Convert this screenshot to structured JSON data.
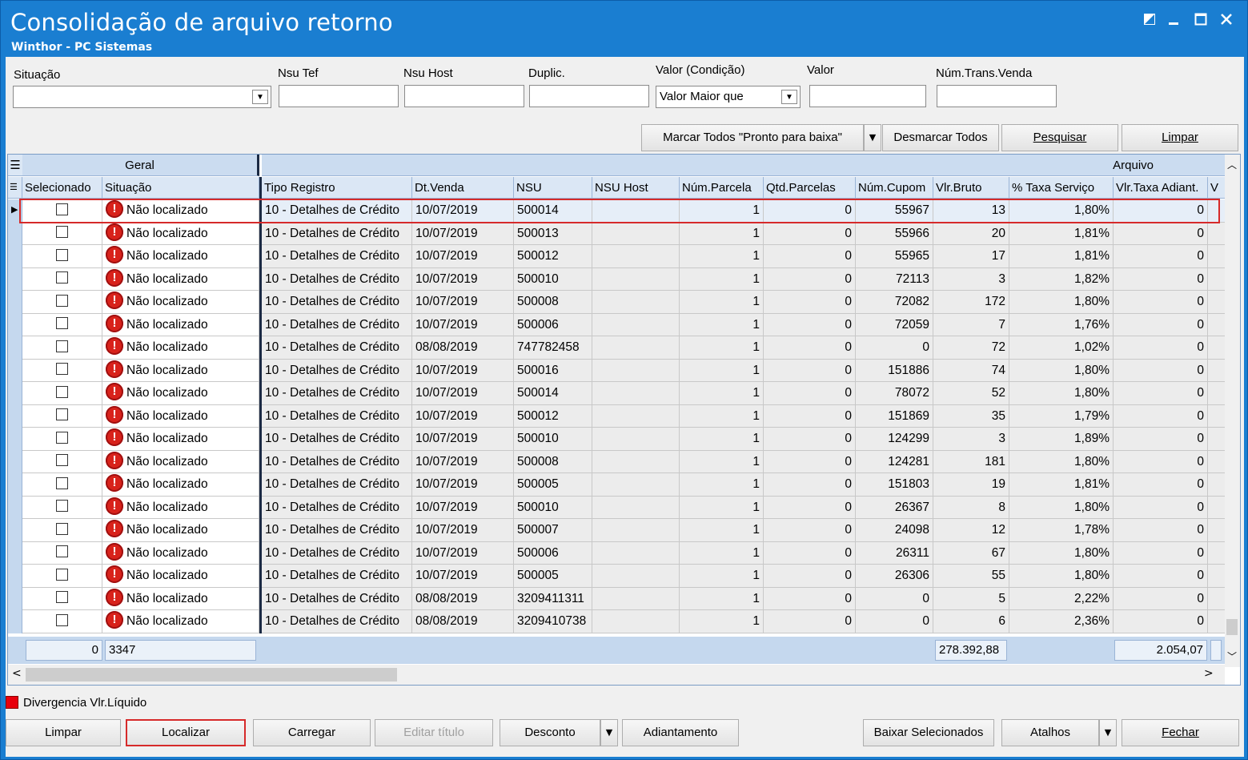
{
  "window": {
    "title": "Consolidação de arquivo retorno",
    "subtitle": "Winthor - PC Sistemas"
  },
  "filters": {
    "situacao_label": "Situação",
    "situacao_value": "",
    "nsu_tef_label": "Nsu Tef",
    "nsu_host_label": "Nsu Host",
    "duplic_label": "Duplic.",
    "valor_condicao_label": "Valor (Condição)",
    "valor_condicao_value": "Valor Maior que",
    "valor_label": "Valor",
    "num_trans_venda_label": "Núm.Trans.Venda"
  },
  "toolbar": {
    "marcar_todos": "Marcar Todos \"Pronto para baixa\"",
    "desmarcar_todos": "Desmarcar Todos",
    "pesquisar": "Pesquisar",
    "limpar": "Limpar"
  },
  "grid": {
    "band_geral": "Geral",
    "band_arquivo": "Arquivo",
    "columns": [
      "Selecionado",
      "Situação",
      "Tipo Registro",
      "Dt.Venda",
      "NSU",
      "NSU Host",
      "Núm.Parcela",
      "Qtd.Parcelas",
      "Núm.Cupom",
      "Vlr.Bruto",
      "% Taxa Serviço",
      "Vlr.Taxa Adiant.",
      "V"
    ],
    "rows": [
      {
        "situacao": "Não localizado",
        "tipo": "10 - Detalhes de Crédito",
        "dt": "10/07/2019",
        "nsu": "500014",
        "nsu_host": "",
        "parcela": "1",
        "qtd": "0",
        "cupom": "55967",
        "bruto": "13",
        "taxa": "1,80%",
        "adiant": "0"
      },
      {
        "situacao": "Não localizado",
        "tipo": "10 - Detalhes de Crédito",
        "dt": "10/07/2019",
        "nsu": "500013",
        "nsu_host": "",
        "parcela": "1",
        "qtd": "0",
        "cupom": "55966",
        "bruto": "20",
        "taxa": "1,81%",
        "adiant": "0"
      },
      {
        "situacao": "Não localizado",
        "tipo": "10 - Detalhes de Crédito",
        "dt": "10/07/2019",
        "nsu": "500012",
        "nsu_host": "",
        "parcela": "1",
        "qtd": "0",
        "cupom": "55965",
        "bruto": "17",
        "taxa": "1,81%",
        "adiant": "0"
      },
      {
        "situacao": "Não localizado",
        "tipo": "10 - Detalhes de Crédito",
        "dt": "10/07/2019",
        "nsu": "500010",
        "nsu_host": "",
        "parcela": "1",
        "qtd": "0",
        "cupom": "72113",
        "bruto": "3",
        "taxa": "1,82%",
        "adiant": "0"
      },
      {
        "situacao": "Não localizado",
        "tipo": "10 - Detalhes de Crédito",
        "dt": "10/07/2019",
        "nsu": "500008",
        "nsu_host": "",
        "parcela": "1",
        "qtd": "0",
        "cupom": "72082",
        "bruto": "172",
        "taxa": "1,80%",
        "adiant": "0"
      },
      {
        "situacao": "Não localizado",
        "tipo": "10 - Detalhes de Crédito",
        "dt": "10/07/2019",
        "nsu": "500006",
        "nsu_host": "",
        "parcela": "1",
        "qtd": "0",
        "cupom": "72059",
        "bruto": "7",
        "taxa": "1,76%",
        "adiant": "0"
      },
      {
        "situacao": "Não localizado",
        "tipo": "10 - Detalhes de Crédito",
        "dt": "08/08/2019",
        "nsu": "747782458",
        "nsu_host": "",
        "parcela": "1",
        "qtd": "0",
        "cupom": "0",
        "bruto": "72",
        "taxa": "1,02%",
        "adiant": "0"
      },
      {
        "situacao": "Não localizado",
        "tipo": "10 - Detalhes de Crédito",
        "dt": "10/07/2019",
        "nsu": "500016",
        "nsu_host": "",
        "parcela": "1",
        "qtd": "0",
        "cupom": "151886",
        "bruto": "74",
        "taxa": "1,80%",
        "adiant": "0"
      },
      {
        "situacao": "Não localizado",
        "tipo": "10 - Detalhes de Crédito",
        "dt": "10/07/2019",
        "nsu": "500014",
        "nsu_host": "",
        "parcela": "1",
        "qtd": "0",
        "cupom": "78072",
        "bruto": "52",
        "taxa": "1,80%",
        "adiant": "0"
      },
      {
        "situacao": "Não localizado",
        "tipo": "10 - Detalhes de Crédito",
        "dt": "10/07/2019",
        "nsu": "500012",
        "nsu_host": "",
        "parcela": "1",
        "qtd": "0",
        "cupom": "151869",
        "bruto": "35",
        "taxa": "1,79%",
        "adiant": "0"
      },
      {
        "situacao": "Não localizado",
        "tipo": "10 - Detalhes de Crédito",
        "dt": "10/07/2019",
        "nsu": "500010",
        "nsu_host": "",
        "parcela": "1",
        "qtd": "0",
        "cupom": "124299",
        "bruto": "3",
        "taxa": "1,89%",
        "adiant": "0"
      },
      {
        "situacao": "Não localizado",
        "tipo": "10 - Detalhes de Crédito",
        "dt": "10/07/2019",
        "nsu": "500008",
        "nsu_host": "",
        "parcela": "1",
        "qtd": "0",
        "cupom": "124281",
        "bruto": "181",
        "taxa": "1,80%",
        "adiant": "0"
      },
      {
        "situacao": "Não localizado",
        "tipo": "10 - Detalhes de Crédito",
        "dt": "10/07/2019",
        "nsu": "500005",
        "nsu_host": "",
        "parcela": "1",
        "qtd": "0",
        "cupom": "151803",
        "bruto": "19",
        "taxa": "1,81%",
        "adiant": "0"
      },
      {
        "situacao": "Não localizado",
        "tipo": "10 - Detalhes de Crédito",
        "dt": "10/07/2019",
        "nsu": "500010",
        "nsu_host": "",
        "parcela": "1",
        "qtd": "0",
        "cupom": "26367",
        "bruto": "8",
        "taxa": "1,80%",
        "adiant": "0"
      },
      {
        "situacao": "Não localizado",
        "tipo": "10 - Detalhes de Crédito",
        "dt": "10/07/2019",
        "nsu": "500007",
        "nsu_host": "",
        "parcela": "1",
        "qtd": "0",
        "cupom": "24098",
        "bruto": "12",
        "taxa": "1,78%",
        "adiant": "0"
      },
      {
        "situacao": "Não localizado",
        "tipo": "10 - Detalhes de Crédito",
        "dt": "10/07/2019",
        "nsu": "500006",
        "nsu_host": "",
        "parcela": "1",
        "qtd": "0",
        "cupom": "26311",
        "bruto": "67",
        "taxa": "1,80%",
        "adiant": "0"
      },
      {
        "situacao": "Não localizado",
        "tipo": "10 - Detalhes de Crédito",
        "dt": "10/07/2019",
        "nsu": "500005",
        "nsu_host": "",
        "parcela": "1",
        "qtd": "0",
        "cupom": "26306",
        "bruto": "55",
        "taxa": "1,80%",
        "adiant": "0"
      },
      {
        "situacao": "Não localizado",
        "tipo": "10 - Detalhes de Crédito",
        "dt": "08/08/2019",
        "nsu": "3209411311",
        "nsu_host": "",
        "parcela": "1",
        "qtd": "0",
        "cupom": "0",
        "bruto": "5",
        "taxa": "2,22%",
        "adiant": "0"
      },
      {
        "situacao": "Não localizado",
        "tipo": "10 - Detalhes de Crédito",
        "dt": "08/08/2019",
        "nsu": "3209410738",
        "nsu_host": "",
        "parcela": "1",
        "qtd": "0",
        "cupom": "0",
        "bruto": "6",
        "taxa": "2,36%",
        "adiant": "0"
      }
    ],
    "footer": {
      "selecionados": "0",
      "count": "3347",
      "total_bruto": "278.392,88",
      "total_adiant": "2.054,07"
    }
  },
  "legend": {
    "label": "Divergencia Vlr.Líquido",
    "color": "#e8000c"
  },
  "bottom_buttons": {
    "limpar": "Limpar",
    "localizar": "Localizar",
    "carregar": "Carregar",
    "editar_titulo": "Editar título",
    "desconto": "Desconto",
    "adiantamento": "Adiantamento",
    "baixar_selecionados": "Baixar Selecionados",
    "atalhos": "Atalhos",
    "fechar": "Fechar"
  },
  "icons": {
    "status": "error-exclamation-icon",
    "restore": "restore-icon",
    "minimize": "minimize-icon",
    "maximize": "maximize-icon",
    "close": "close-icon"
  }
}
